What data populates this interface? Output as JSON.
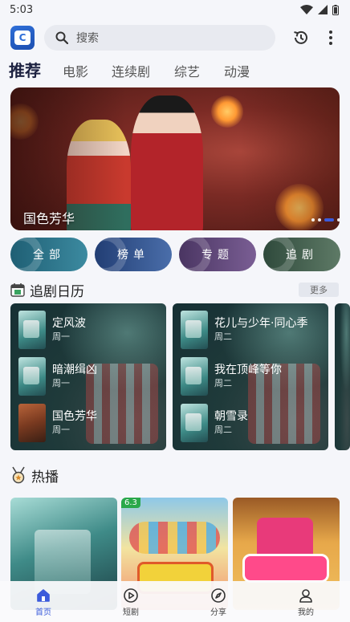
{
  "status": {
    "time": "5:03"
  },
  "search": {
    "placeholder": "搜索"
  },
  "tabs": [
    {
      "label": "推荐",
      "active": true
    },
    {
      "label": "电影",
      "active": false
    },
    {
      "label": "连续剧",
      "active": false
    },
    {
      "label": "综艺",
      "active": false
    },
    {
      "label": "动漫",
      "active": false
    }
  ],
  "banner": {
    "title": "国色芳华",
    "slide_count": 4,
    "active_slide": 3
  },
  "categories": [
    {
      "label": "全部",
      "color": "#2a6f86"
    },
    {
      "label": "榜单",
      "color": "#2f4f86"
    },
    {
      "label": "专题",
      "color": "#5c4672"
    },
    {
      "label": "追剧",
      "color": "#3f5a4a"
    }
  ],
  "calendar": {
    "title": "追剧日历",
    "more": "更多",
    "columns": [
      {
        "items": [
          {
            "name": "定风波",
            "day": "周一"
          },
          {
            "name": "暗潮缉凶",
            "day": "周一"
          },
          {
            "name": "国色芳华",
            "day": "周一"
          }
        ]
      },
      {
        "items": [
          {
            "name": "花儿与少年·同心季",
            "day": "周二"
          },
          {
            "name": "我在顶峰等你",
            "day": "周二"
          },
          {
            "name": "朝雪录",
            "day": "周二"
          }
        ]
      }
    ]
  },
  "hot": {
    "title": "热播",
    "cards": [
      {
        "score": ""
      },
      {
        "score": "6.3"
      },
      {
        "score": ""
      }
    ]
  },
  "nav": [
    {
      "label": "首页",
      "active": true,
      "icon": "home-icon"
    },
    {
      "label": "短剧",
      "active": false,
      "icon": "play-circle-icon"
    },
    {
      "label": "分享",
      "active": false,
      "icon": "compass-icon"
    },
    {
      "label": "我的",
      "active": false,
      "icon": "user-icon"
    }
  ],
  "colors": {
    "accent": "#3b5bdb",
    "score_badge": "#2aa84a"
  }
}
